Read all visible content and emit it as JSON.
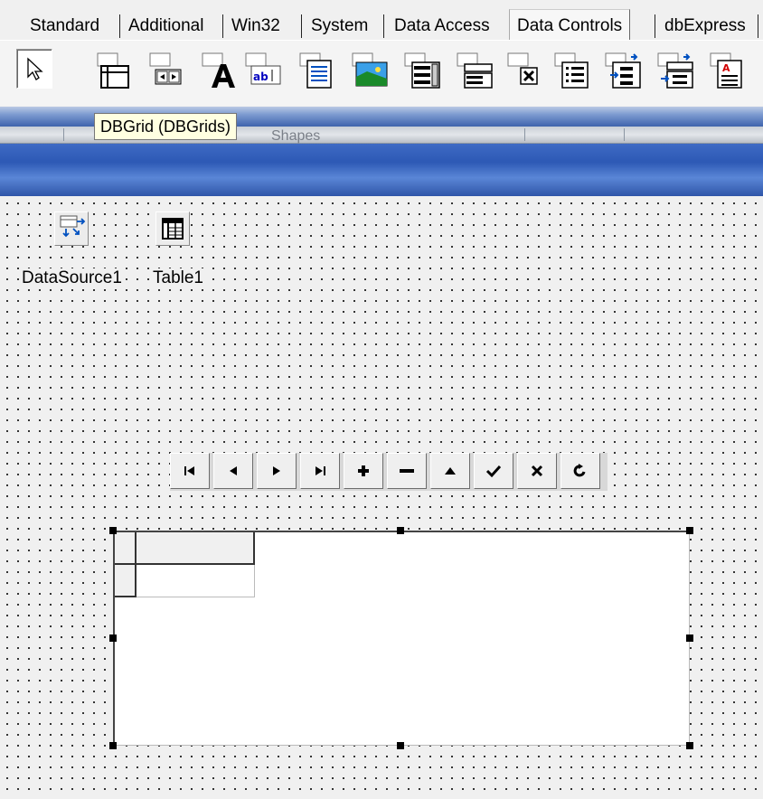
{
  "palette_tabs": [
    {
      "label": "Standard"
    },
    {
      "label": "Additional"
    },
    {
      "label": "Win32"
    },
    {
      "label": "System"
    },
    {
      "label": "Data Access"
    },
    {
      "label": "Data Controls",
      "active": true
    },
    {
      "label": "dbExpress"
    }
  ],
  "toolbar": {
    "pointer": {
      "icon": "arrow-pointer-icon"
    },
    "components": [
      {
        "icon": "dbgrid-icon"
      },
      {
        "icon": "dbnavigator-icon"
      },
      {
        "icon": "dbtext-icon"
      },
      {
        "icon": "dbedit-icon"
      },
      {
        "icon": "dbmemo-icon"
      },
      {
        "icon": "dbimage-icon"
      },
      {
        "icon": "dblistbox-icon"
      },
      {
        "icon": "dbcombobox-icon"
      },
      {
        "icon": "dbcheckbox-icon"
      },
      {
        "icon": "dbradiogroup-icon"
      },
      {
        "icon": "dblookuplistbox-icon"
      },
      {
        "icon": "dblookupcombobox-icon"
      },
      {
        "icon": "dbrichedit-icon"
      }
    ]
  },
  "tooltip": {
    "text": "DBGrid (DBGrids)"
  },
  "band": {
    "shapes_label": "Shapes"
  },
  "form": {
    "components": [
      {
        "icon": "datasource-icon",
        "label": "DataSource1"
      },
      {
        "icon": "table-icon",
        "label": "Table1"
      }
    ],
    "navigator": {
      "buttons": [
        {
          "icon": "first-record-icon"
        },
        {
          "icon": "prior-record-icon"
        },
        {
          "icon": "next-record-icon"
        },
        {
          "icon": "last-record-icon"
        },
        {
          "icon": "insert-record-icon"
        },
        {
          "icon": "delete-record-icon"
        },
        {
          "icon": "edit-record-icon"
        },
        {
          "icon": "post-record-icon"
        },
        {
          "icon": "cancel-record-icon"
        },
        {
          "icon": "refresh-record-icon"
        }
      ]
    }
  },
  "colors": {
    "tooltip_bg": "#ffffe1",
    "titlebar": "#2d59b5",
    "band": "#3f64ad"
  }
}
